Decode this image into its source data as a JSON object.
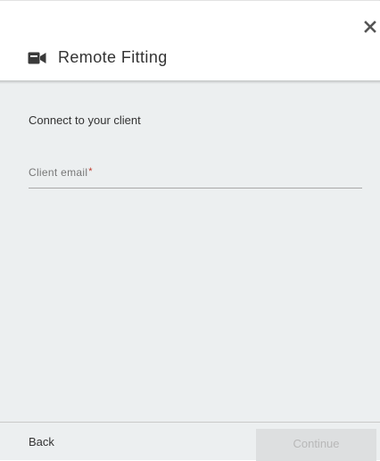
{
  "dialog": {
    "title": "Remote Fitting",
    "title_icon": "video-camera-icon",
    "close_icon": "close-icon"
  },
  "body": {
    "heading": "Connect to your client",
    "email_field": {
      "label": "Client email",
      "required_marker": "*",
      "value": "",
      "placeholder": ""
    }
  },
  "footer": {
    "back_label": "Back",
    "continue_label": "Continue",
    "continue_enabled": false
  },
  "colors": {
    "body_background": "#eceff0",
    "required_marker": "#c0392b",
    "disabled_button_bg": "#dddfe0",
    "disabled_button_text": "#b8b8b8"
  }
}
